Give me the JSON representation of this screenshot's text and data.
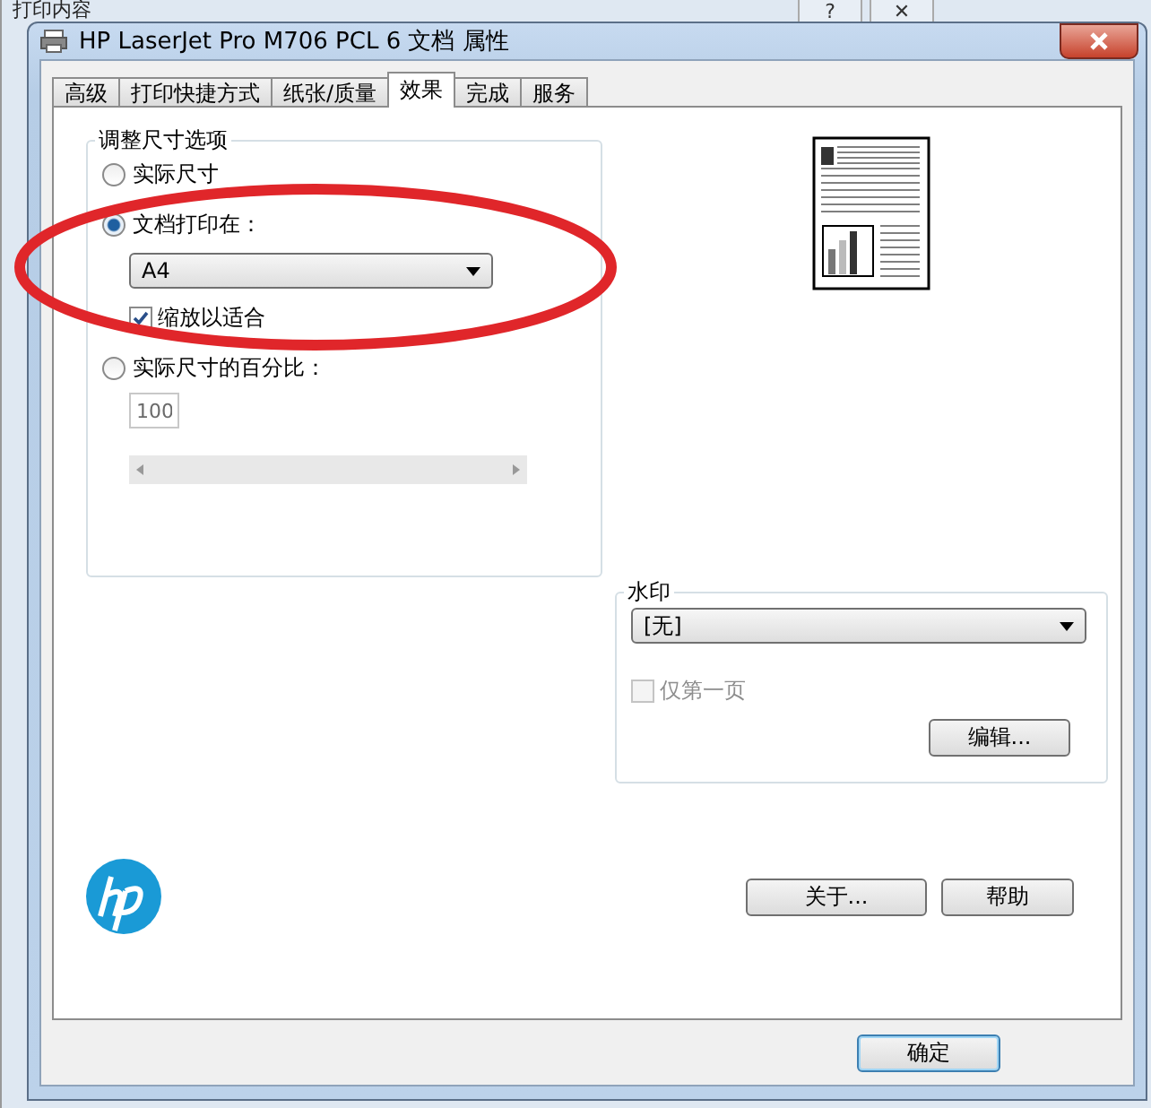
{
  "background_window": {
    "title": "打印内容",
    "buttons": [
      "?",
      "✕"
    ]
  },
  "window": {
    "title": "HP LaserJet Pro M706 PCL 6 文档 属性"
  },
  "tabs": [
    {
      "label": "高级",
      "selected": false
    },
    {
      "label": "打印快捷方式",
      "selected": false
    },
    {
      "label": "纸张/质量",
      "selected": false
    },
    {
      "label": "效果",
      "selected": true
    },
    {
      "label": "完成",
      "selected": false
    },
    {
      "label": "服务",
      "selected": false
    }
  ],
  "resize": {
    "legend": "调整尺寸选项",
    "modes": [
      {
        "label": "实际尺寸",
        "selected": false
      },
      {
        "label": "文档打印在：",
        "selected": true
      },
      {
        "label": "实际尺寸的百分比：",
        "selected": false
      }
    ],
    "paper": "A4",
    "scale_to_fit": {
      "label": "缩放以适合",
      "checked": true
    },
    "percent": {
      "value": "100",
      "disabled": true
    }
  },
  "watermark": {
    "legend": "水印",
    "value": "[无]",
    "first_page_only": {
      "label": "仅第一页",
      "checked": false,
      "disabled": true
    },
    "edit_button": "编辑..."
  },
  "buttons": [
    "关于...",
    "帮助"
  ],
  "footer_buttons": [
    "确定"
  ],
  "annotation": {
    "kind": "ellipse"
  }
}
